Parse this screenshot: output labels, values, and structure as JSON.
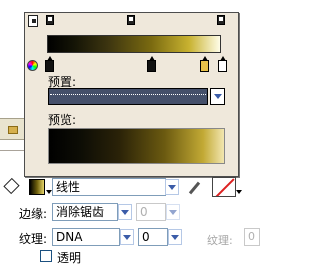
{
  "gradient_editor": {
    "preset_label": "预置:",
    "preview_label": "预览:",
    "preset_value": ""
  },
  "fill": {
    "type_value": "线性"
  },
  "edge": {
    "label": "边缘:",
    "value": "消除锯齿",
    "amount": "0"
  },
  "texture": {
    "label": "纹理:",
    "value": "DNA",
    "amount": "0",
    "right_label": "纹理:",
    "right_value": "0"
  },
  "transparent": {
    "label": "透明"
  },
  "colors": {
    "popup_bg": "#efe8db",
    "accent": "#3b5ca8"
  }
}
